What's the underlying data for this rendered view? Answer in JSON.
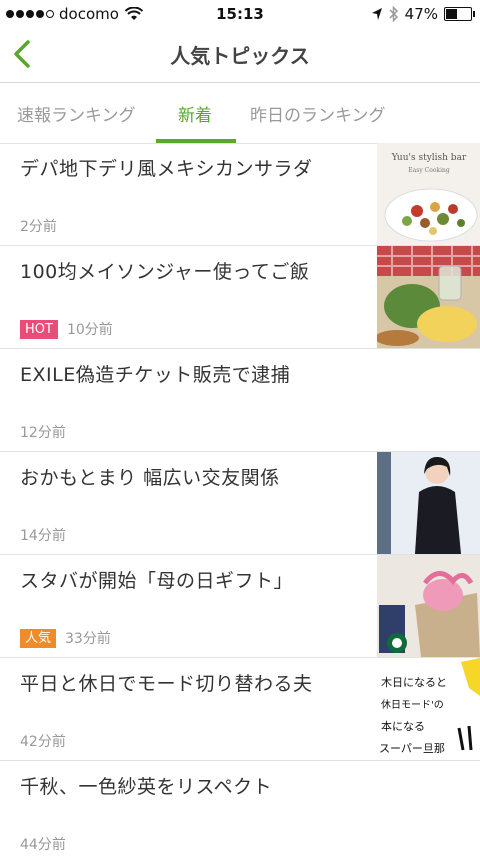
{
  "status": {
    "carrier": "docomo",
    "time": "15:13",
    "battery": "47%",
    "battery_level": 0.47
  },
  "nav": {
    "title": "人気トピックス"
  },
  "tabs": [
    {
      "label": "速報ランキング"
    },
    {
      "label": "新着"
    },
    {
      "label": "昨日のランキング"
    }
  ],
  "colors": {
    "accent": "#5aa72d",
    "hot": "#e94c79",
    "popular": "#ef8c2a"
  },
  "items": [
    {
      "title": "デパ地下デリ風メキシカンサラダ",
      "time": "2分前",
      "badge": "",
      "thumb_caption": "Yuu's stylish bar",
      "thumb_sub": "Easy Cooking"
    },
    {
      "title": "100均メイソンジャー使ってご飯",
      "time": "10分前",
      "badge": "HOT"
    },
    {
      "title": "EXILE偽造チケット販売で逮捕",
      "time": "12分前",
      "badge": ""
    },
    {
      "title": "おかもとまり 幅広い交友関係",
      "time": "14分前",
      "badge": ""
    },
    {
      "title": "スタバが開始「母の日ギフト」",
      "time": "33分前",
      "badge": "人気"
    },
    {
      "title": "平日と休日でモード切り替わる夫",
      "time": "42分前",
      "badge": "",
      "thumb_text": [
        "木日になると",
        "休日モード'の",
        "本になる",
        "スーパー旦那"
      ]
    },
    {
      "title": "千秋、一色紗英をリスペクト",
      "time": "44分前",
      "badge": ""
    }
  ]
}
